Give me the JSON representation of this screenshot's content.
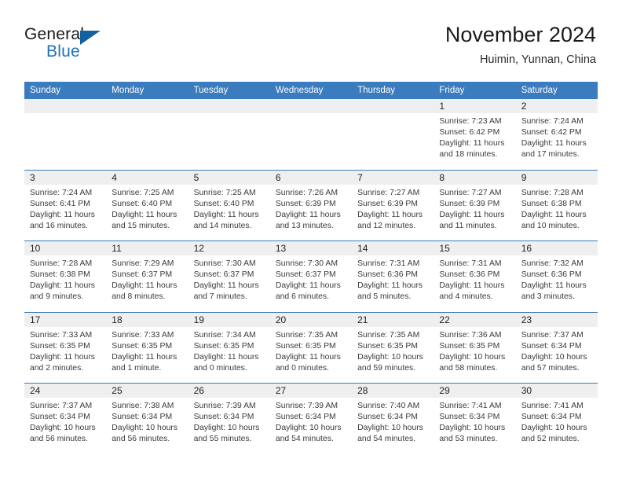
{
  "brand": {
    "word1": "General",
    "word2": "Blue",
    "logo_icon": "triangle-icon",
    "accent_color": "#1c72bc"
  },
  "header": {
    "title": "November 2024",
    "subtitle": "Huimin, Yunnan, China"
  },
  "theme": {
    "header_bar": "#3a7cbe",
    "day_band": "#efefef",
    "text": "#3b3b3b"
  },
  "weekdays": [
    "Sunday",
    "Monday",
    "Tuesday",
    "Wednesday",
    "Thursday",
    "Friday",
    "Saturday"
  ],
  "weeks": [
    [
      {
        "day": "",
        "empty": true,
        "lines": []
      },
      {
        "day": "",
        "empty": true,
        "lines": []
      },
      {
        "day": "",
        "empty": true,
        "lines": []
      },
      {
        "day": "",
        "empty": true,
        "lines": []
      },
      {
        "day": "",
        "empty": true,
        "lines": []
      },
      {
        "day": "1",
        "empty": false,
        "lines": [
          "Sunrise: 7:23 AM",
          "Sunset: 6:42 PM",
          "Daylight: 11 hours",
          "and 18 minutes."
        ]
      },
      {
        "day": "2",
        "empty": false,
        "lines": [
          "Sunrise: 7:24 AM",
          "Sunset: 6:42 PM",
          "Daylight: 11 hours",
          "and 17 minutes."
        ]
      }
    ],
    [
      {
        "day": "3",
        "empty": false,
        "lines": [
          "Sunrise: 7:24 AM",
          "Sunset: 6:41 PM",
          "Daylight: 11 hours",
          "and 16 minutes."
        ]
      },
      {
        "day": "4",
        "empty": false,
        "lines": [
          "Sunrise: 7:25 AM",
          "Sunset: 6:40 PM",
          "Daylight: 11 hours",
          "and 15 minutes."
        ]
      },
      {
        "day": "5",
        "empty": false,
        "lines": [
          "Sunrise: 7:25 AM",
          "Sunset: 6:40 PM",
          "Daylight: 11 hours",
          "and 14 minutes."
        ]
      },
      {
        "day": "6",
        "empty": false,
        "lines": [
          "Sunrise: 7:26 AM",
          "Sunset: 6:39 PM",
          "Daylight: 11 hours",
          "and 13 minutes."
        ]
      },
      {
        "day": "7",
        "empty": false,
        "lines": [
          "Sunrise: 7:27 AM",
          "Sunset: 6:39 PM",
          "Daylight: 11 hours",
          "and 12 minutes."
        ]
      },
      {
        "day": "8",
        "empty": false,
        "lines": [
          "Sunrise: 7:27 AM",
          "Sunset: 6:39 PM",
          "Daylight: 11 hours",
          "and 11 minutes."
        ]
      },
      {
        "day": "9",
        "empty": false,
        "lines": [
          "Sunrise: 7:28 AM",
          "Sunset: 6:38 PM",
          "Daylight: 11 hours",
          "and 10 minutes."
        ]
      }
    ],
    [
      {
        "day": "10",
        "empty": false,
        "lines": [
          "Sunrise: 7:28 AM",
          "Sunset: 6:38 PM",
          "Daylight: 11 hours",
          "and 9 minutes."
        ]
      },
      {
        "day": "11",
        "empty": false,
        "lines": [
          "Sunrise: 7:29 AM",
          "Sunset: 6:37 PM",
          "Daylight: 11 hours",
          "and 8 minutes."
        ]
      },
      {
        "day": "12",
        "empty": false,
        "lines": [
          "Sunrise: 7:30 AM",
          "Sunset: 6:37 PM",
          "Daylight: 11 hours",
          "and 7 minutes."
        ]
      },
      {
        "day": "13",
        "empty": false,
        "lines": [
          "Sunrise: 7:30 AM",
          "Sunset: 6:37 PM",
          "Daylight: 11 hours",
          "and 6 minutes."
        ]
      },
      {
        "day": "14",
        "empty": false,
        "lines": [
          "Sunrise: 7:31 AM",
          "Sunset: 6:36 PM",
          "Daylight: 11 hours",
          "and 5 minutes."
        ]
      },
      {
        "day": "15",
        "empty": false,
        "lines": [
          "Sunrise: 7:31 AM",
          "Sunset: 6:36 PM",
          "Daylight: 11 hours",
          "and 4 minutes."
        ]
      },
      {
        "day": "16",
        "empty": false,
        "lines": [
          "Sunrise: 7:32 AM",
          "Sunset: 6:36 PM",
          "Daylight: 11 hours",
          "and 3 minutes."
        ]
      }
    ],
    [
      {
        "day": "17",
        "empty": false,
        "lines": [
          "Sunrise: 7:33 AM",
          "Sunset: 6:35 PM",
          "Daylight: 11 hours",
          "and 2 minutes."
        ]
      },
      {
        "day": "18",
        "empty": false,
        "lines": [
          "Sunrise: 7:33 AM",
          "Sunset: 6:35 PM",
          "Daylight: 11 hours",
          "and 1 minute."
        ]
      },
      {
        "day": "19",
        "empty": false,
        "lines": [
          "Sunrise: 7:34 AM",
          "Sunset: 6:35 PM",
          "Daylight: 11 hours",
          "and 0 minutes."
        ]
      },
      {
        "day": "20",
        "empty": false,
        "lines": [
          "Sunrise: 7:35 AM",
          "Sunset: 6:35 PM",
          "Daylight: 11 hours",
          "and 0 minutes."
        ]
      },
      {
        "day": "21",
        "empty": false,
        "lines": [
          "Sunrise: 7:35 AM",
          "Sunset: 6:35 PM",
          "Daylight: 10 hours",
          "and 59 minutes."
        ]
      },
      {
        "day": "22",
        "empty": false,
        "lines": [
          "Sunrise: 7:36 AM",
          "Sunset: 6:35 PM",
          "Daylight: 10 hours",
          "and 58 minutes."
        ]
      },
      {
        "day": "23",
        "empty": false,
        "lines": [
          "Sunrise: 7:37 AM",
          "Sunset: 6:34 PM",
          "Daylight: 10 hours",
          "and 57 minutes."
        ]
      }
    ],
    [
      {
        "day": "24",
        "empty": false,
        "lines": [
          "Sunrise: 7:37 AM",
          "Sunset: 6:34 PM",
          "Daylight: 10 hours",
          "and 56 minutes."
        ]
      },
      {
        "day": "25",
        "empty": false,
        "lines": [
          "Sunrise: 7:38 AM",
          "Sunset: 6:34 PM",
          "Daylight: 10 hours",
          "and 56 minutes."
        ]
      },
      {
        "day": "26",
        "empty": false,
        "lines": [
          "Sunrise: 7:39 AM",
          "Sunset: 6:34 PM",
          "Daylight: 10 hours",
          "and 55 minutes."
        ]
      },
      {
        "day": "27",
        "empty": false,
        "lines": [
          "Sunrise: 7:39 AM",
          "Sunset: 6:34 PM",
          "Daylight: 10 hours",
          "and 54 minutes."
        ]
      },
      {
        "day": "28",
        "empty": false,
        "lines": [
          "Sunrise: 7:40 AM",
          "Sunset: 6:34 PM",
          "Daylight: 10 hours",
          "and 54 minutes."
        ]
      },
      {
        "day": "29",
        "empty": false,
        "lines": [
          "Sunrise: 7:41 AM",
          "Sunset: 6:34 PM",
          "Daylight: 10 hours",
          "and 53 minutes."
        ]
      },
      {
        "day": "30",
        "empty": false,
        "lines": [
          "Sunrise: 7:41 AM",
          "Sunset: 6:34 PM",
          "Daylight: 10 hours",
          "and 52 minutes."
        ]
      }
    ]
  ]
}
